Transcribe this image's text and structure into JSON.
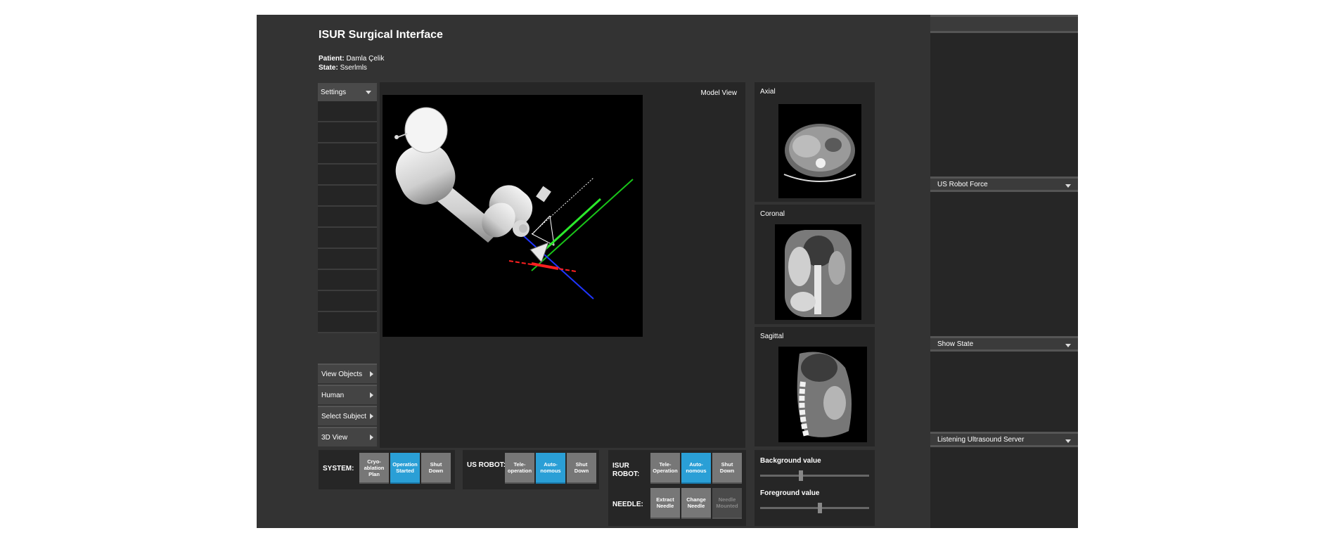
{
  "app": {
    "title": "ISUR Surgical Interface",
    "patient_label": "Patient:",
    "patient_name": "Damla Çelik",
    "state_label": "State:",
    "state_value": "Sserlmls"
  },
  "left_panel": {
    "settings_label": "Settings",
    "nav": [
      {
        "label": "View Objects"
      },
      {
        "label": "Human"
      },
      {
        "label": "Select Subject"
      },
      {
        "label": "3D View"
      }
    ]
  },
  "model_view": {
    "label": "Model View"
  },
  "slices": [
    {
      "label": "Axial"
    },
    {
      "label": "Coronal"
    },
    {
      "label": "Sagittal"
    }
  ],
  "system_bar": {
    "label": "SYSTEM:",
    "buttons": [
      "Cryo-ablation Plan",
      "Operation Started",
      "Shut Down"
    ]
  },
  "us_robot_bar": {
    "label": "US ROBOT:",
    "buttons": [
      "Tele-operation",
      "Auto-nomous",
      "Shut Down"
    ]
  },
  "isur_robot_bar": {
    "label": "ISUR ROBOT:",
    "buttons": [
      "Tele-Operation",
      "Auto-nomous",
      "Shut Down"
    ]
  },
  "needle_bar": {
    "label": "NEEDLE:",
    "buttons": [
      "Extract Needle",
      "Change Needle",
      "Needle Mounted"
    ]
  },
  "sliders": {
    "background_label": "Background value",
    "background_value": 0.37,
    "foreground_label": "Foreground value",
    "foreground_value": 0.55
  },
  "right_panel": {
    "sections": [
      "US Robot Force",
      "Show State",
      "Listening Ultrasound Server"
    ]
  },
  "colors": {
    "accent": "#2a9fd6",
    "panel": "#262626",
    "background": "#333333"
  }
}
